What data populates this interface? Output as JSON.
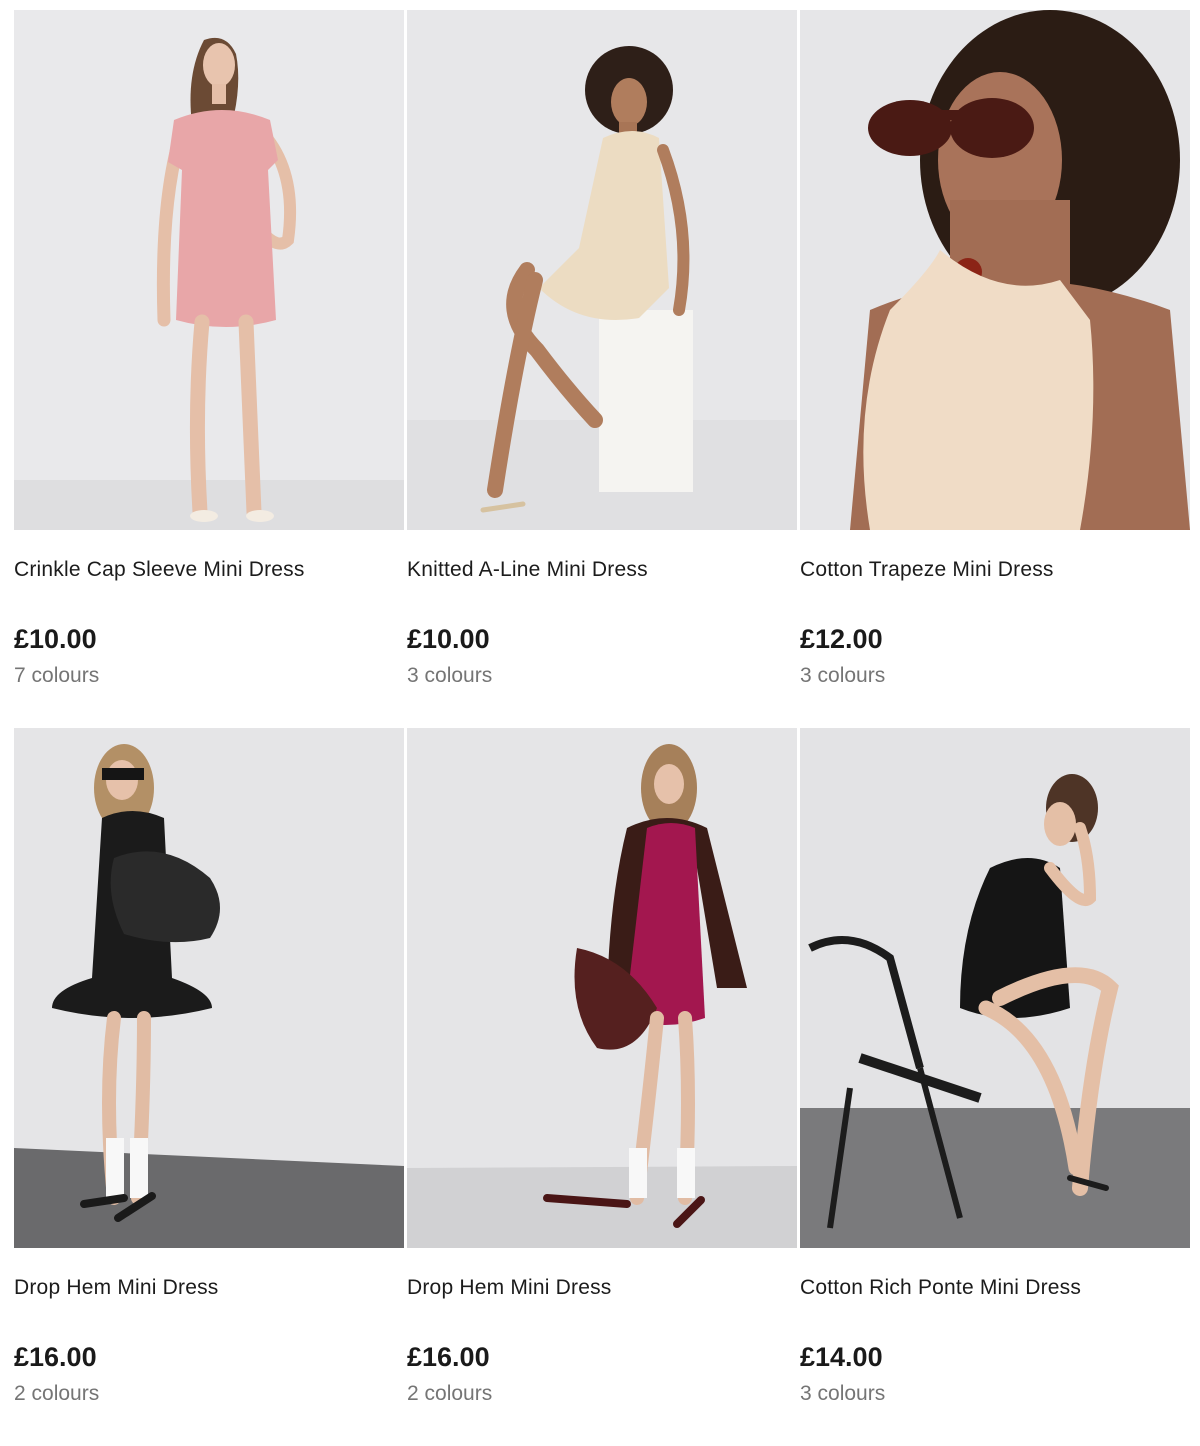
{
  "products": [
    {
      "name": "Crinkle Cap Sleeve Mini Dress",
      "price": "£10.00",
      "colours": "7 colours",
      "image_icon": "model-pink-mini-dress-photo",
      "dress_color": "#e8a6a8"
    },
    {
      "name": "Knitted A-Line Mini Dress",
      "price": "£10.00",
      "colours": "3 colours",
      "image_icon": "model-cream-knitted-dress-photo",
      "dress_color": "#ecdcc2"
    },
    {
      "name": "Cotton Trapeze Mini Dress",
      "price": "£12.00",
      "colours": "3 colours",
      "image_icon": "model-peach-trapeze-dress-photo",
      "dress_color": "#f0dcc6"
    },
    {
      "name": "Drop Hem Mini Dress",
      "price": "£16.00",
      "colours": "2 colours",
      "image_icon": "model-black-drop-hem-dress-photo",
      "dress_color": "#1b1b1b"
    },
    {
      "name": "Drop Hem Mini Dress",
      "price": "£16.00",
      "colours": "2 colours",
      "image_icon": "model-magenta-drop-hem-dress-photo",
      "dress_color": "#a3174f"
    },
    {
      "name": "Cotton Rich Ponte Mini Dress",
      "price": "£14.00",
      "colours": "3 colours",
      "image_icon": "model-black-ponte-dress-photo",
      "dress_color": "#151515"
    }
  ]
}
